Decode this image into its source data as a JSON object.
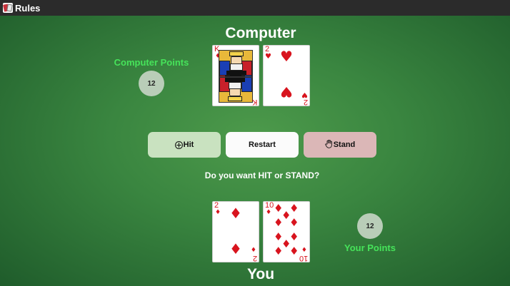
{
  "window": {
    "title": "Rules",
    "icon": "playing-cards-icon"
  },
  "computer": {
    "heading": "Computer",
    "points_label": "Computer Points",
    "points": "12",
    "cards": [
      {
        "rank": "K",
        "suit": "diamonds",
        "suit_symbol": "♦"
      },
      {
        "rank": "2",
        "suit": "hearts",
        "suit_symbol": "♥"
      }
    ]
  },
  "buttons": {
    "hit": {
      "label": "Hit",
      "icon": "plus-circle-icon"
    },
    "restart": {
      "label": "Restart"
    },
    "stand": {
      "label": "Stand",
      "icon": "hand-icon"
    }
  },
  "prompt": "Do you want HIT or STAND?",
  "player": {
    "heading": "You",
    "points_label": "Your Points",
    "points": "12",
    "cards": [
      {
        "rank": "2",
        "suit": "diamonds",
        "suit_symbol": "♦"
      },
      {
        "rank": "10",
        "suit": "diamonds",
        "suit_symbol": "♦"
      }
    ]
  },
  "colors": {
    "felt": "#3a8640",
    "points_label": "#46e35a",
    "suit_red": "#d8141e",
    "hit_button": "#c9e2c0",
    "restart_button": "#fbfbfb",
    "stand_button": "#dbb7b7"
  }
}
